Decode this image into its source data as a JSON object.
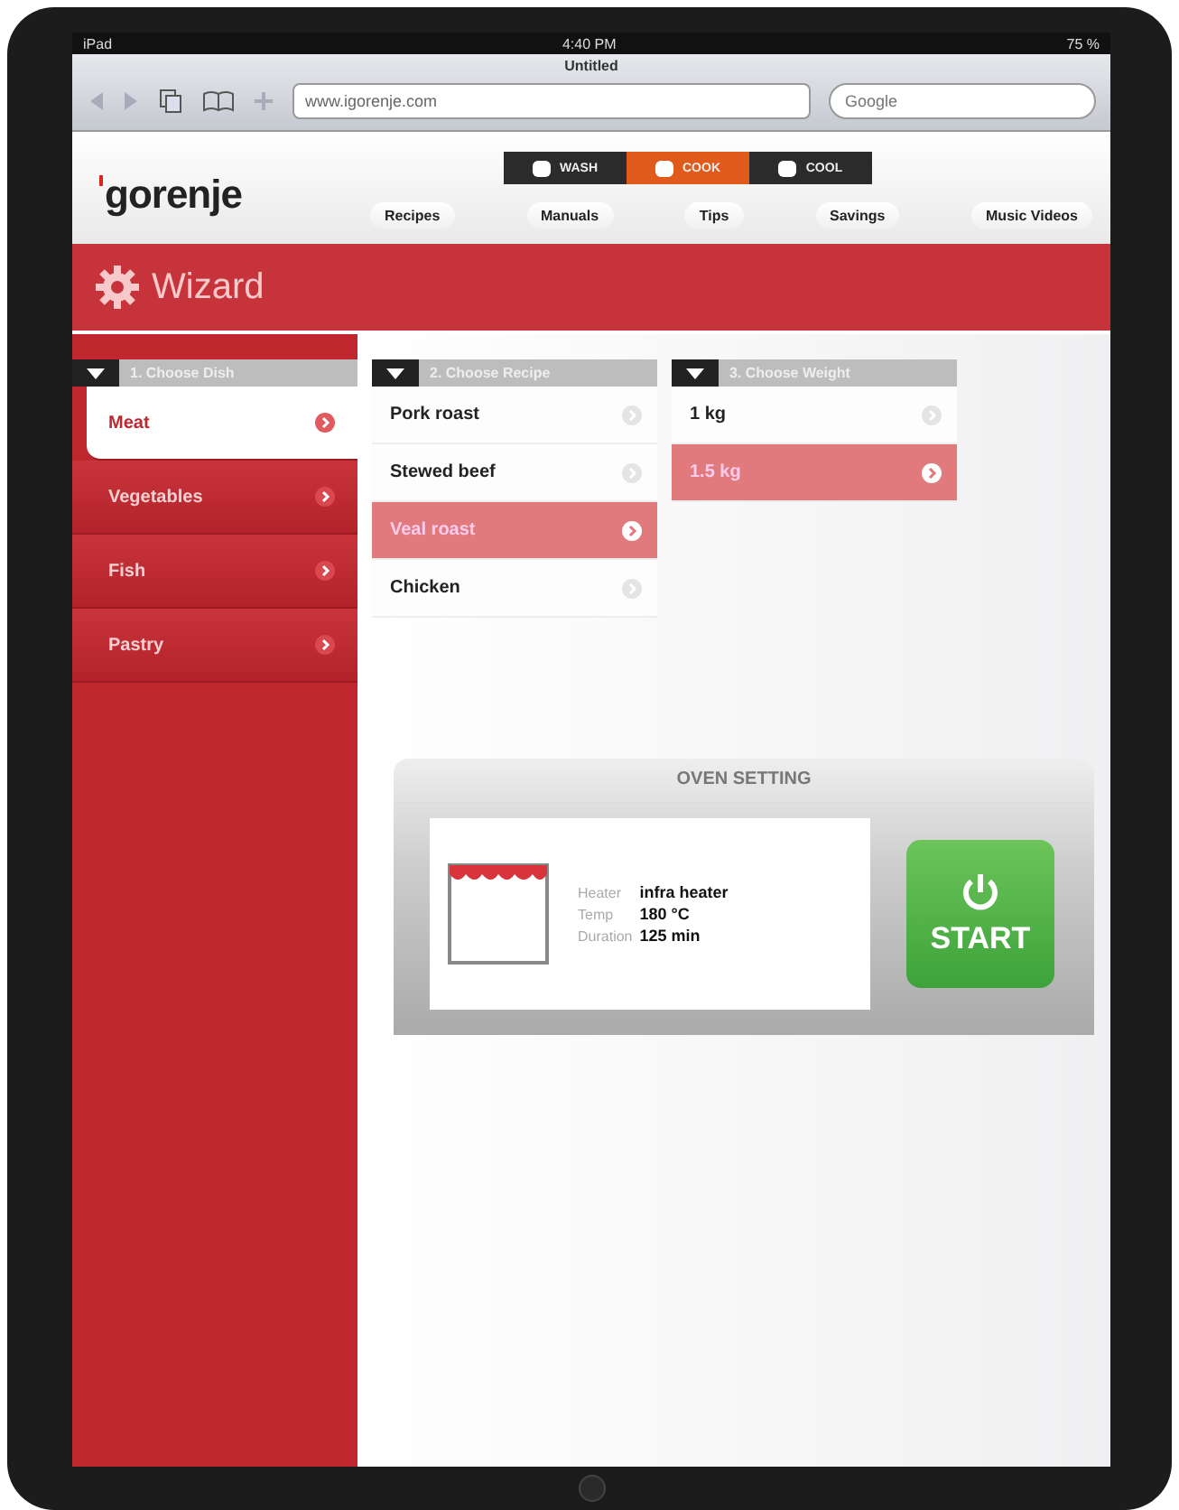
{
  "status_bar": {
    "device": "iPad",
    "time": "4:40 PM",
    "battery": "75 %"
  },
  "browser": {
    "title": "Untitled",
    "url": "www.igorenje.com",
    "search": {
      "placeholder": "Google"
    }
  },
  "site": {
    "logo": "gorenje",
    "modes": [
      {
        "label": "WASH",
        "selected": false
      },
      {
        "label": "COOK",
        "selected": true
      },
      {
        "label": "COOL",
        "selected": false
      }
    ],
    "nav": [
      "Recipes",
      "Manuals",
      "Tips",
      "Savings",
      "Music Videos"
    ]
  },
  "wizard": {
    "title": "Wizard",
    "columns": [
      {
        "kind": "category",
        "header": "1. Choose Dish",
        "items": [
          {
            "label": "Meat",
            "selected": true
          },
          {
            "label": "Vegetables",
            "selected": false
          },
          {
            "label": "Fish",
            "selected": false
          },
          {
            "label": "Pastry",
            "selected": false
          }
        ]
      },
      {
        "kind": "option",
        "header": "2. Choose Recipe",
        "items": [
          {
            "label": "Pork roast",
            "selected": false
          },
          {
            "label": "Stewed beef",
            "selected": false
          },
          {
            "label": "Veal roast",
            "selected": true
          },
          {
            "label": "Chicken",
            "selected": false
          }
        ]
      },
      {
        "kind": "option",
        "header": "3. Choose Weight",
        "items": [
          {
            "label": "1 kg",
            "selected": false
          },
          {
            "label": "1.5 kg",
            "selected": true
          }
        ]
      }
    ]
  },
  "oven": {
    "title": "OVEN SETTING",
    "settings": [
      {
        "label": "Heater",
        "value": "infra heater"
      },
      {
        "label": "Temp",
        "value": "180 °C"
      },
      {
        "label": "Duration",
        "value": "125 min"
      }
    ],
    "start": "START"
  }
}
